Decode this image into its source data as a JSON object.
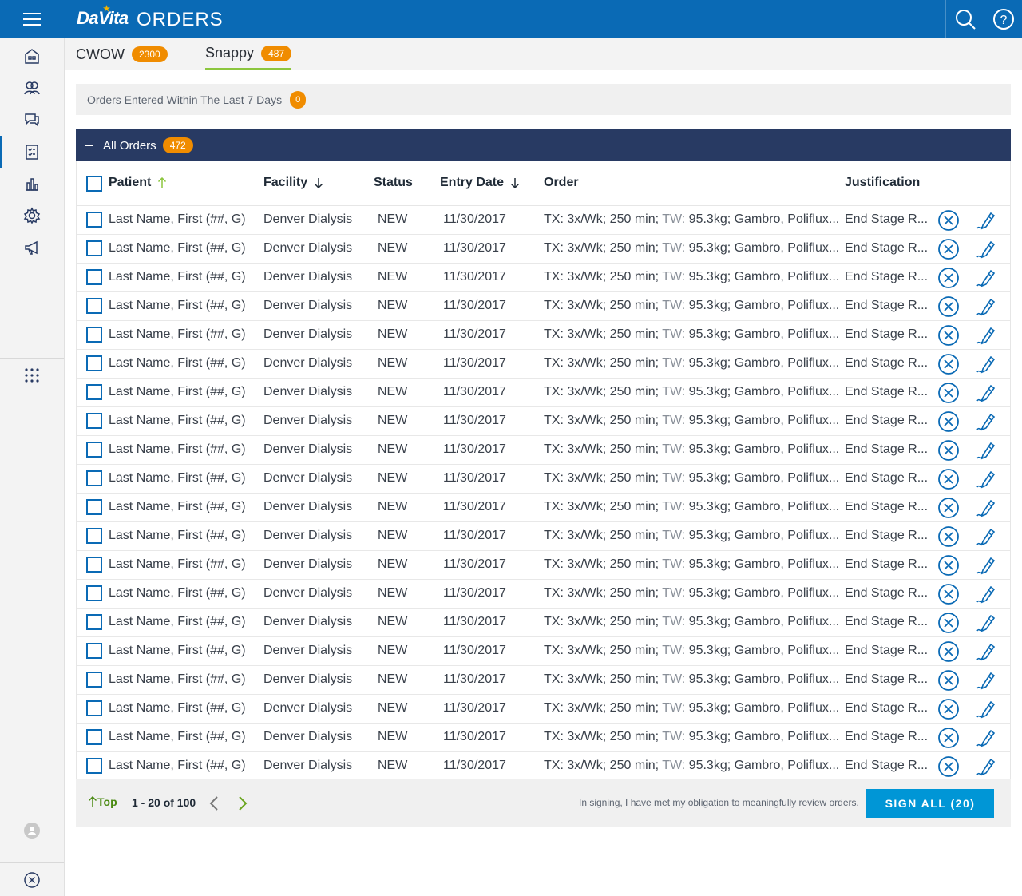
{
  "header": {
    "brand": "DaVita",
    "title": "ORDERS"
  },
  "tabs": [
    {
      "label": "CWOW",
      "count": "2300"
    },
    {
      "label": "Snappy",
      "count": "487"
    }
  ],
  "recent": {
    "label": "Orders Entered Within The Last 7 Days",
    "count": "0"
  },
  "orders_group": {
    "label": "All Orders",
    "count": "472"
  },
  "table": {
    "columns": {
      "patient": "Patient",
      "facility": "Facility",
      "status": "Status",
      "entry_date": "Entry Date",
      "order": "Order",
      "justification": "Justification"
    },
    "rows": [
      {
        "patient": "Last Name, First (##, G)",
        "facility": "Denver Dialysis",
        "status": "NEW",
        "date": "11/30/2017",
        "order_tx": "TX: 3x/Wk; 250 min; ",
        "order_tw_label": "TW:",
        "order_rest": " 95.3kg; Gambro, Poliflux...",
        "justification": "End Stage R..."
      },
      {
        "patient": "Last Name, First (##, G)",
        "facility": "Denver Dialysis",
        "status": "NEW",
        "date": "11/30/2017",
        "order_tx": "TX: 3x/Wk; 250 min; ",
        "order_tw_label": "TW:",
        "order_rest": " 95.3kg; Gambro, Poliflux...",
        "justification": "End Stage R..."
      },
      {
        "patient": "Last Name, First (##, G)",
        "facility": "Denver Dialysis",
        "status": "NEW",
        "date": "11/30/2017",
        "order_tx": "TX: 3x/Wk; 250 min; ",
        "order_tw_label": "TW:",
        "order_rest": " 95.3kg; Gambro, Poliflux...",
        "justification": "End Stage R..."
      },
      {
        "patient": "Last Name, First (##, G)",
        "facility": "Denver Dialysis",
        "status": "NEW",
        "date": "11/30/2017",
        "order_tx": "TX: 3x/Wk; 250 min; ",
        "order_tw_label": "TW:",
        "order_rest": " 95.3kg; Gambro, Poliflux...",
        "justification": "End Stage R..."
      },
      {
        "patient": "Last Name, First (##, G)",
        "facility": "Denver Dialysis",
        "status": "NEW",
        "date": "11/30/2017",
        "order_tx": "TX: 3x/Wk; 250 min; ",
        "order_tw_label": "TW:",
        "order_rest": " 95.3kg; Gambro, Poliflux...",
        "justification": "End Stage R..."
      },
      {
        "patient": "Last Name, First (##, G)",
        "facility": "Denver Dialysis",
        "status": "NEW",
        "date": "11/30/2017",
        "order_tx": "TX: 3x/Wk; 250 min; ",
        "order_tw_label": "TW:",
        "order_rest": " 95.3kg; Gambro, Poliflux...",
        "justification": "End Stage R..."
      },
      {
        "patient": "Last Name, First (##, G)",
        "facility": "Denver Dialysis",
        "status": "NEW",
        "date": "11/30/2017",
        "order_tx": "TX: 3x/Wk; 250 min; ",
        "order_tw_label": "TW:",
        "order_rest": " 95.3kg; Gambro, Poliflux...",
        "justification": "End Stage R..."
      },
      {
        "patient": "Last Name, First (##, G)",
        "facility": "Denver Dialysis",
        "status": "NEW",
        "date": "11/30/2017",
        "order_tx": "TX: 3x/Wk; 250 min; ",
        "order_tw_label": "TW:",
        "order_rest": " 95.3kg; Gambro, Poliflux...",
        "justification": "End Stage R..."
      },
      {
        "patient": "Last Name, First (##, G)",
        "facility": "Denver Dialysis",
        "status": "NEW",
        "date": "11/30/2017",
        "order_tx": "TX: 3x/Wk; 250 min; ",
        "order_tw_label": "TW:",
        "order_rest": " 95.3kg; Gambro, Poliflux...",
        "justification": "End Stage R..."
      },
      {
        "patient": "Last Name, First (##, G)",
        "facility": "Denver Dialysis",
        "status": "NEW",
        "date": "11/30/2017",
        "order_tx": "TX: 3x/Wk; 250 min; ",
        "order_tw_label": "TW:",
        "order_rest": " 95.3kg; Gambro, Poliflux...",
        "justification": "End Stage R..."
      },
      {
        "patient": "Last Name, First (##, G)",
        "facility": "Denver Dialysis",
        "status": "NEW",
        "date": "11/30/2017",
        "order_tx": "TX: 3x/Wk; 250 min; ",
        "order_tw_label": "TW:",
        "order_rest": " 95.3kg; Gambro, Poliflux...",
        "justification": "End Stage R..."
      },
      {
        "patient": "Last Name, First (##, G)",
        "facility": "Denver Dialysis",
        "status": "NEW",
        "date": "11/30/2017",
        "order_tx": "TX: 3x/Wk; 250 min; ",
        "order_tw_label": "TW:",
        "order_rest": " 95.3kg; Gambro, Poliflux...",
        "justification": "End Stage R..."
      },
      {
        "patient": "Last Name, First (##, G)",
        "facility": "Denver Dialysis",
        "status": "NEW",
        "date": "11/30/2017",
        "order_tx": "TX: 3x/Wk; 250 min; ",
        "order_tw_label": "TW:",
        "order_rest": " 95.3kg; Gambro, Poliflux...",
        "justification": "End Stage R..."
      },
      {
        "patient": "Last Name, First (##, G)",
        "facility": "Denver Dialysis",
        "status": "NEW",
        "date": "11/30/2017",
        "order_tx": "TX: 3x/Wk; 250 min; ",
        "order_tw_label": "TW:",
        "order_rest": " 95.3kg; Gambro, Poliflux...",
        "justification": "End Stage R..."
      },
      {
        "patient": "Last Name, First (##, G)",
        "facility": "Denver Dialysis",
        "status": "NEW",
        "date": "11/30/2017",
        "order_tx": "TX: 3x/Wk; 250 min; ",
        "order_tw_label": "TW:",
        "order_rest": " 95.3kg; Gambro, Poliflux...",
        "justification": "End Stage R..."
      },
      {
        "patient": "Last Name, First (##, G)",
        "facility": "Denver Dialysis",
        "status": "NEW",
        "date": "11/30/2017",
        "order_tx": "TX: 3x/Wk; 250 min; ",
        "order_tw_label": "TW:",
        "order_rest": " 95.3kg; Gambro, Poliflux...",
        "justification": "End Stage R..."
      },
      {
        "patient": "Last Name, First (##, G)",
        "facility": "Denver Dialysis",
        "status": "NEW",
        "date": "11/30/2017",
        "order_tx": "TX: 3x/Wk; 250 min; ",
        "order_tw_label": "TW:",
        "order_rest": " 95.3kg; Gambro, Poliflux...",
        "justification": "End Stage R..."
      },
      {
        "patient": "Last Name, First (##, G)",
        "facility": "Denver Dialysis",
        "status": "NEW",
        "date": "11/30/2017",
        "order_tx": "TX: 3x/Wk; 250 min; ",
        "order_tw_label": "TW:",
        "order_rest": " 95.3kg; Gambro, Poliflux...",
        "justification": "End Stage R..."
      },
      {
        "patient": "Last Name, First (##, G)",
        "facility": "Denver Dialysis",
        "status": "NEW",
        "date": "11/30/2017",
        "order_tx": "TX: 3x/Wk; 250 min; ",
        "order_tw_label": "TW:",
        "order_rest": " 95.3kg; Gambro, Poliflux...",
        "justification": "End Stage R..."
      },
      {
        "patient": "Last Name, First (##, G)",
        "facility": "Denver Dialysis",
        "status": "NEW",
        "date": "11/30/2017",
        "order_tx": "TX: 3x/Wk; 250 min; ",
        "order_tw_label": "TW:",
        "order_rest": " 95.3kg; Gambro, Poliflux...",
        "justification": "End Stage R..."
      }
    ]
  },
  "footer": {
    "top_label": "Top",
    "pager": "1 - 20 of 100",
    "attestation": "In signing, I have met my obligation to meaningfully review orders.",
    "sign_all": "SIGN ALL (20)"
  },
  "sidebar": {
    "items": [
      "home-icon",
      "patients-icon",
      "chat-icon",
      "orders-icon",
      "reports-icon",
      "settings-icon",
      "announcements-icon"
    ],
    "active": "orders-icon"
  },
  "colors": {
    "brand_blue": "#0a6ab5",
    "navy": "#283a63",
    "badge_orange": "#f08c00",
    "accent_green": "#8cc63e",
    "button_blue": "#0096d6"
  }
}
